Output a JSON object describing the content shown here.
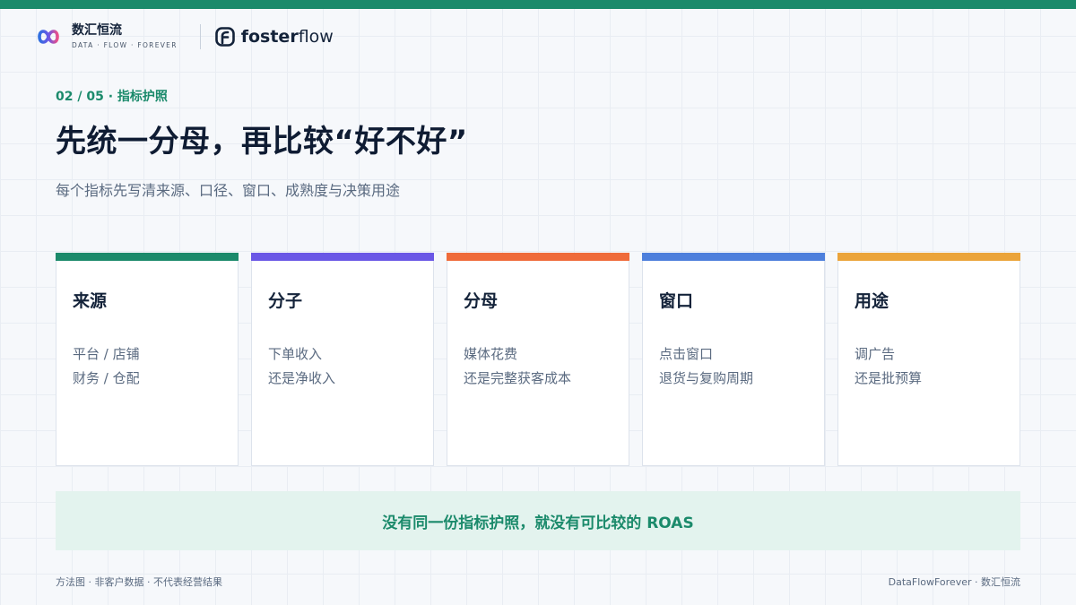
{
  "colors": {
    "brand": "#1b8a6b",
    "text": "#14233a",
    "muted": "#5a6a80",
    "callout_bg": "#e3f3ee"
  },
  "brand": {
    "icon": "infinity-logo-icon",
    "name_cn": "数汇恒流",
    "tagline": "DATA · FLOW · FOREVER"
  },
  "partner": {
    "icon": "fosterflow-f-icon",
    "name_bold": "foster",
    "name_light": "flow"
  },
  "slide": {
    "eyebrow": "02 / 05 · 指标护照",
    "title": "先统一分母，再比较“好不好”",
    "subtitle": "每个指标先写清来源、口径、窗口、成熟度与决策用途"
  },
  "cards": [
    {
      "title": "来源",
      "lines": [
        "平台 / 店铺",
        "财务 / 仓配"
      ],
      "accent": "#1b8a6b"
    },
    {
      "title": "分子",
      "lines": [
        "下单收入",
        "还是净收入"
      ],
      "accent": "#6a57e6"
    },
    {
      "title": "分母",
      "lines": [
        "媒体花费",
        "还是完整获客成本"
      ],
      "accent": "#ef6b3a"
    },
    {
      "title": "窗口",
      "lines": [
        "点击窗口",
        "退货与复购周期"
      ],
      "accent": "#4d7fdc"
    },
    {
      "title": "用途",
      "lines": [
        "调广告",
        "还是批预算"
      ],
      "accent": "#eba43a"
    }
  ],
  "callout": "没有同一份指标护照，就没有可比较的 ROAS",
  "footer": {
    "left": "方法图 · 非客户数据 · 不代表经营结果",
    "right": "DataFlowForever · 数汇恒流"
  }
}
